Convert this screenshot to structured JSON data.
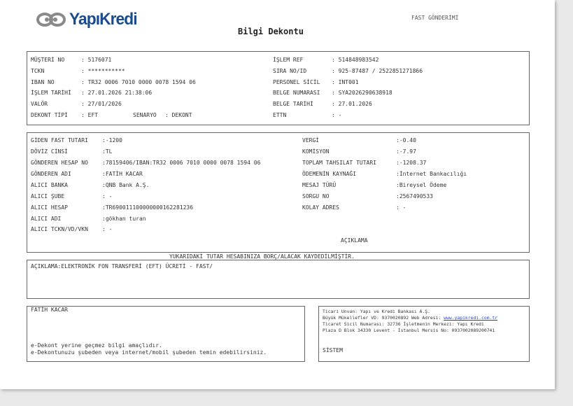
{
  "logo": {
    "text": "YapıKredi"
  },
  "header": {
    "transfer_type": "FAST GÖNDERİMİ",
    "title": "Bilgi Dekontu"
  },
  "customer_box": {
    "left": [
      {
        "label": "MÜŞTERİ NO",
        "value": "5176071"
      },
      {
        "label": "TCKN",
        "value": "***********"
      },
      {
        "label": "IBAN NO",
        "value": "TR32 0006 7010 0000 0078 1594 06"
      },
      {
        "label": "İŞLEM TARİHİ",
        "value": "27.01.2026 21:38:06"
      },
      {
        "label": "VALÖR",
        "value": "27/01/2026"
      },
      {
        "label": "DEKONT TİPİ",
        "value": "EFT",
        "extra_label": "SENARYO",
        "extra_value": "DEKONT"
      }
    ],
    "right": [
      {
        "label": "İŞLEM REF",
        "value": "514848983542"
      },
      {
        "label": "SIRA NO/ID",
        "value": "925-87487 / 2522851271866"
      },
      {
        "label": "PERSONEL SİCİL",
        "value": "INT001"
      },
      {
        "label": "BELGE NUMARASI",
        "value": "SYA2026290638918"
      },
      {
        "label": "BELGE TARİHİ",
        "value": "27.01.2026"
      },
      {
        "label": "ETTN",
        "value": "-"
      }
    ]
  },
  "transfer_box": {
    "left": [
      {
        "label": "GİDEN FAST TUTARI",
        "value": "-1200"
      },
      {
        "label": "DÖVİZ CİNSİ",
        "value": "TL"
      },
      {
        "label": "GÖNDEREN HESAP NO",
        "value": "78159406/IBAN:TR32 0006 7010 0000 0078 1594 06"
      },
      {
        "label": "GÖNDEREN ADI",
        "value": "FATİH KACAR"
      },
      {
        "label": "ALICI BANKA",
        "value": "QNB Bank A.Ş."
      },
      {
        "label": "ALICI ŞUBE",
        "value": "-"
      },
      {
        "label": "ALICI HESAP",
        "value": "TR690011100000000162281236"
      },
      {
        "label": "ALICI ADI",
        "value": "gökhan turan"
      },
      {
        "label": "ALICI TCKN/VD/VKN",
        "value": "-"
      }
    ],
    "right": [
      {
        "label": "VERGİ",
        "value": "-0.40"
      },
      {
        "label": "KOMİSYON",
        "value": "-7.97"
      },
      {
        "label": "TOPLAM TAHSILAT TUTARI",
        "value": "-1208.37"
      },
      {
        "label": "ÖDEMENİN KAYNAĞI",
        "value": "İnternet Bankacılığı"
      },
      {
        "label": "MESAJ TÜRÜ",
        "value": "Bireysel Ödeme"
      },
      {
        "label": "SORGU NO",
        "value": "2567490533"
      },
      {
        "label": "KOLAY ADRES",
        "value": "-"
      }
    ],
    "aciklama_header": "AÇIKLAMA"
  },
  "notice": "YUKARIDAKİ TUTAR HESABINIZA BORÇ/ALACAK KAYDEDİLMİŞTİR.",
  "description": "AÇIKLAMA:ELEKTRONİK FON TRANSFERİ (EFT) ÜCRETİ - FAST/",
  "footer_left": {
    "name": "FATİH KACAR",
    "line1": "e-Dekont yerine geçmez bilgi amaçlıdır.",
    "line2": "e-Dekontunuzu şubeden veya internet/mobil şubeden temin edebilirsiniz."
  },
  "footer_right": {
    "line1": "Ticari Unvan: Yapı ve Kredi Bankası A.Ş.",
    "line2_pre": "Büyük Mükellefler VD: 9370020892 Web Adresi: ",
    "web": "www.yapikredi.com.tr",
    "line3": "Ticaret Sicil Numarası: 32736 İşletmenin Merkezi: Yapı Kredi",
    "line4": "Plaza D Blok 34330 Levent - İstanbul Mersis No: 0937002089200741",
    "system": "SİSTEM"
  }
}
